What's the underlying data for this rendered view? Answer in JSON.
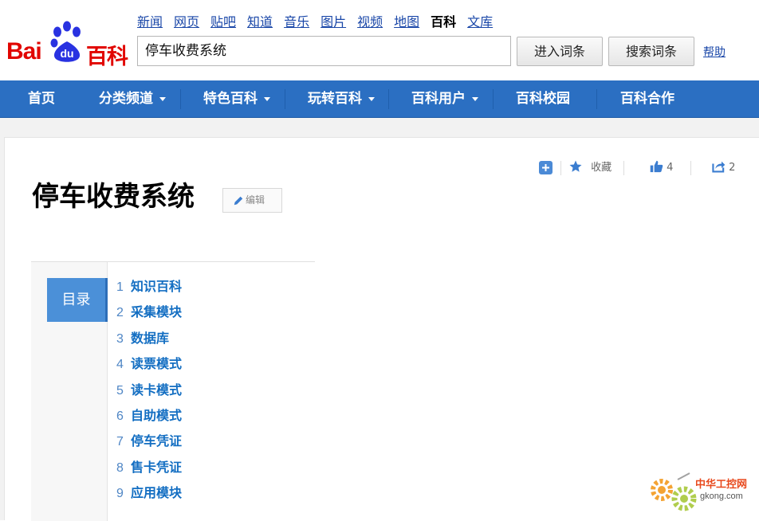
{
  "header": {
    "logo_bai": "Bai",
    "logo_du": "du",
    "logo_baike": "百科",
    "nav_links": [
      "新闻",
      "网页",
      "贴吧",
      "知道",
      "音乐",
      "图片",
      "视频",
      "地图"
    ],
    "nav_current": "百科",
    "nav_after": "文库",
    "search_value": "停车收费系统",
    "btn_enter": "进入词条",
    "btn_search": "搜索词条",
    "help": "帮助"
  },
  "main_nav": {
    "items": [
      {
        "label": "首页",
        "dropdown": false
      },
      {
        "label": "分类频道",
        "dropdown": true
      },
      {
        "label": "特色百科",
        "dropdown": true
      },
      {
        "label": "玩转百科",
        "dropdown": true
      },
      {
        "label": "百科用户",
        "dropdown": true
      },
      {
        "label": "百科校园",
        "dropdown": false
      },
      {
        "label": "百科合作",
        "dropdown": false
      }
    ]
  },
  "article": {
    "title": "停车收费系统",
    "edit_label": "编辑",
    "favorite_label": "收藏",
    "like_count": "4",
    "share_count": "2"
  },
  "catalog": {
    "heading": "目录",
    "items": [
      {
        "num": "1",
        "text": "知识百科"
      },
      {
        "num": "2",
        "text": "采集模块"
      },
      {
        "num": "3",
        "text": "数据库"
      },
      {
        "num": "4",
        "text": "读票模式"
      },
      {
        "num": "5",
        "text": "读卡模式"
      },
      {
        "num": "6",
        "text": "自助模式"
      },
      {
        "num": "7",
        "text": "停车凭证"
      },
      {
        "num": "8",
        "text": "售卡凭证"
      },
      {
        "num": "9",
        "text": "应用模块"
      }
    ]
  },
  "watermark": {
    "title": "中华工控网",
    "url": "gkong.com"
  },
  "colors": {
    "nav_blue": "#2b6fc2",
    "link_blue": "#1a47a8",
    "logo_red": "#e10601",
    "logo_blue": "#2932e1",
    "catalog_blue": "#4b90d8"
  }
}
